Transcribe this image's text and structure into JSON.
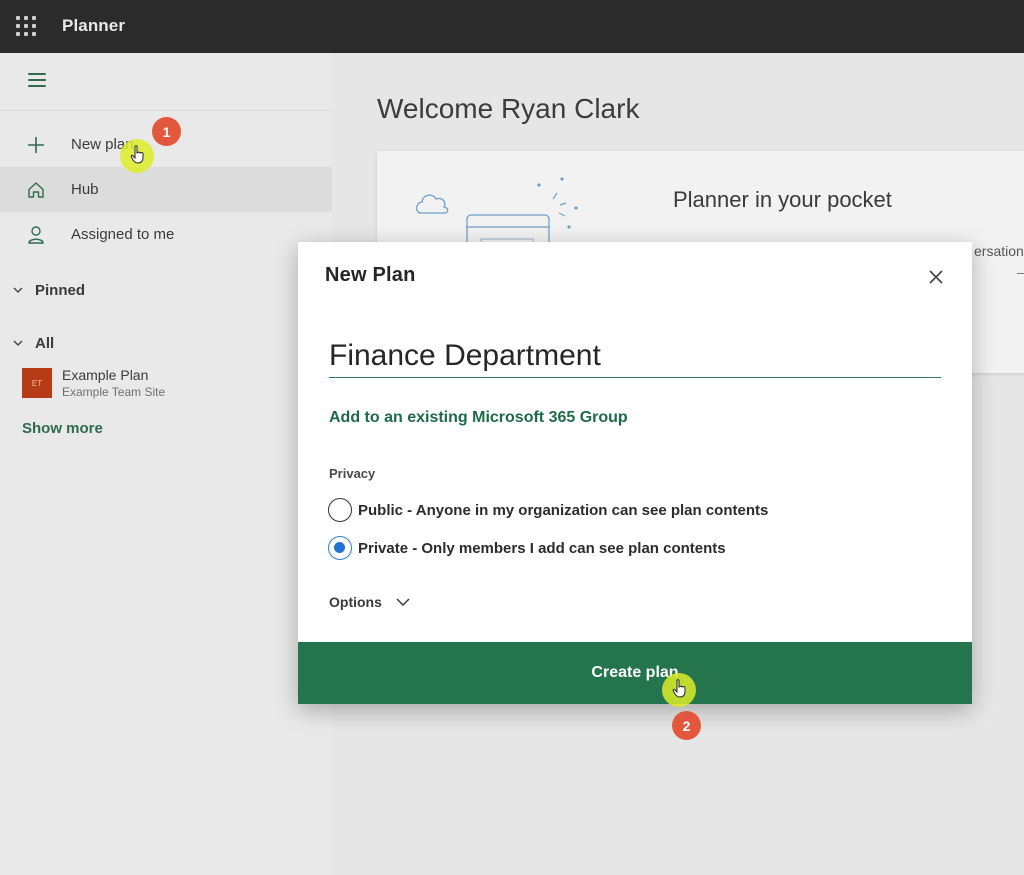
{
  "topbar": {
    "app_title": "Planner"
  },
  "sidebar": {
    "nav": [
      {
        "label": "New plan",
        "icon": "plus-icon"
      },
      {
        "label": "Hub",
        "icon": "home-icon"
      },
      {
        "label": "Assigned to me",
        "icon": "person-icon"
      }
    ],
    "pinned_label": "Pinned",
    "all_label": "All",
    "plans": [
      {
        "initials": "ET",
        "name": "Example Plan",
        "site": "Example Team Site"
      }
    ],
    "show_more": "Show more"
  },
  "main": {
    "welcome": "Welcome Ryan Clark",
    "pocket_title": "Planner in your pocket",
    "pocket_snippet": "ersations"
  },
  "modal": {
    "title": "New Plan",
    "plan_name": "Finance Department",
    "group_link": "Add to an existing Microsoft 365 Group",
    "privacy_label": "Privacy",
    "privacy_options": [
      {
        "label": "Public - Anyone in my organization can see plan contents",
        "selected": false
      },
      {
        "label": "Private - Only members I add can see plan contents",
        "selected": true
      }
    ],
    "options_label": "Options",
    "create_button": "Create plan"
  },
  "annotations": {
    "step1": "1",
    "step2": "2"
  },
  "colors": {
    "accent": "#24754d",
    "topbar": "#2b2b2b",
    "badge": "#e3573d",
    "radio_selected": "#1f74d1"
  }
}
